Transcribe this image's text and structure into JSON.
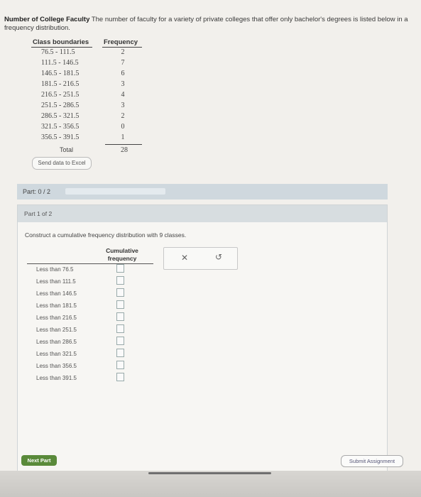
{
  "problem": {
    "title": "Number of College Faculty",
    "text": "The number of faculty for a variety of private colleges that offer only bachelor's degrees is listed below in a frequency distribution."
  },
  "freq_table": {
    "header_boundaries": "Class boundaries",
    "header_frequency": "Frequency",
    "rows": [
      {
        "boundaries": "76.5 - 111.5",
        "frequency": "2"
      },
      {
        "boundaries": "111.5 - 146.5",
        "frequency": "7"
      },
      {
        "boundaries": "146.5 - 181.5",
        "frequency": "6"
      },
      {
        "boundaries": "181.5 - 216.5",
        "frequency": "3"
      },
      {
        "boundaries": "216.5 - 251.5",
        "frequency": "4"
      },
      {
        "boundaries": "251.5 - 286.5",
        "frequency": "3"
      },
      {
        "boundaries": "286.5 - 321.5",
        "frequency": "2"
      },
      {
        "boundaries": "321.5 - 356.5",
        "frequency": "0"
      },
      {
        "boundaries": "356.5 - 391.5",
        "frequency": "1"
      }
    ],
    "total_label": "Total",
    "total_value": "28"
  },
  "send_excel_label": "Send data to Excel",
  "part_bar": {
    "label": "Part: 0 / 2",
    "progress": 0
  },
  "part": {
    "header": "Part 1 of 2",
    "prompt": "Construct a cumulative frequency distribution with 9 classes.",
    "cum_header_line1": "Cumulative",
    "cum_header_line2": "frequency",
    "rows": [
      {
        "label": "Less than 76.5",
        "value": ""
      },
      {
        "label": "Less than 111.5",
        "value": ""
      },
      {
        "label": "Less than 146.5",
        "value": ""
      },
      {
        "label": "Less than 181.5",
        "value": ""
      },
      {
        "label": "Less than 216.5",
        "value": ""
      },
      {
        "label": "Less than 251.5",
        "value": ""
      },
      {
        "label": "Less than 286.5",
        "value": ""
      },
      {
        "label": "Less than 321.5",
        "value": ""
      },
      {
        "label": "Less than 356.5",
        "value": ""
      },
      {
        "label": "Less than 391.5",
        "value": ""
      }
    ],
    "clear_icon": "close-icon",
    "undo_icon": "undo-icon"
  },
  "buttons": {
    "next": "Next Part",
    "submit": "Submit Assignment"
  },
  "colors": {
    "next_button": "#5a8a3a",
    "part_bar": "#cfd8de"
  }
}
